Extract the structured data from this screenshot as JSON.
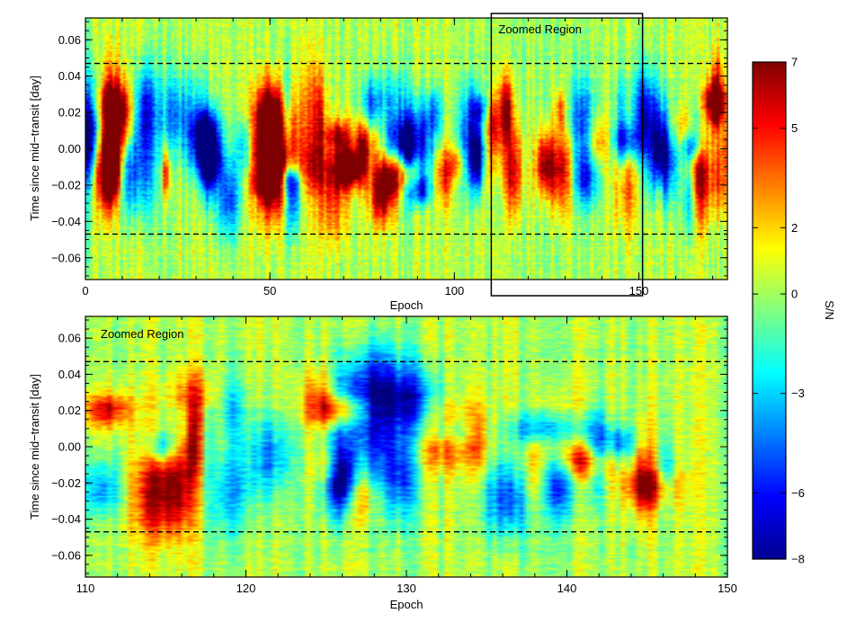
{
  "chart_data": [
    {
      "type": "heatmap",
      "title": "",
      "xlabel": "Epoch",
      "ylabel": "Time since mid−transit [day]",
      "xlim": [
        0,
        174
      ],
      "ylim": [
        -0.072,
        0.072
      ],
      "x_ticks": [
        0,
        50,
        100,
        150
      ],
      "x_tick_labels": [
        "0",
        "50",
        "100",
        "150"
      ],
      "y_ticks": [
        0.06,
        0.04,
        0.02,
        0.0,
        -0.02,
        -0.04,
        -0.06
      ],
      "y_tick_labels": [
        "0.06",
        "0.04",
        "0.02",
        "0.00",
        "−0.02",
        "−0.04",
        "−0.06"
      ],
      "dashed_lines_y": [
        0.047,
        -0.047
      ],
      "annotation": {
        "text": "Zoomed Region",
        "x_range": [
          110,
          151
        ]
      },
      "z_label": "S/N",
      "z_range": [
        -8,
        7
      ]
    },
    {
      "type": "heatmap",
      "title": "",
      "xlabel": "Epoch",
      "ylabel": "Time since mid−transit [day]",
      "xlim": [
        110,
        150
      ],
      "ylim": [
        -0.072,
        0.072
      ],
      "x_ticks": [
        110,
        120,
        130,
        140,
        150
      ],
      "x_tick_labels": [
        "110",
        "120",
        "130",
        "140",
        "150"
      ],
      "y_ticks": [
        0.06,
        0.04,
        0.02,
        0.0,
        -0.02,
        -0.04,
        -0.06
      ],
      "y_tick_labels": [
        "0.06",
        "0.04",
        "0.02",
        "0.00",
        "−0.02",
        "−0.04",
        "−0.06"
      ],
      "dashed_lines_y": [
        0.047,
        -0.047
      ],
      "annotation": {
        "text": "Zoomed Region"
      },
      "z_label": "S/N",
      "z_range": [
        -8,
        7
      ]
    }
  ],
  "colorbar": {
    "label": "S/N",
    "min": -8,
    "max": 7,
    "ticks": [
      7,
      5,
      2,
      0,
      -3,
      -6,
      -8
    ],
    "tick_labels": [
      "7",
      "5",
      "2",
      "0",
      "−3",
      "−6",
      "−8"
    ],
    "colormap": "jet"
  }
}
